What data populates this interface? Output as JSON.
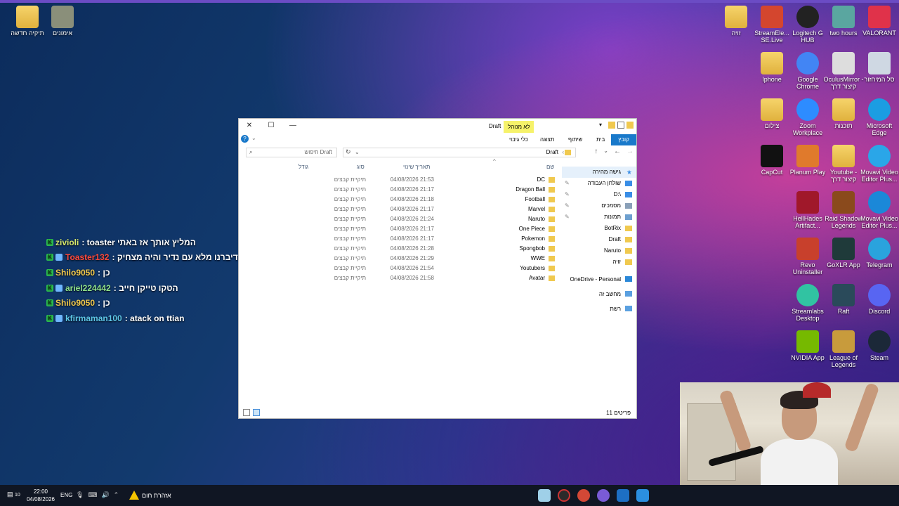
{
  "desktop": {
    "left_icons": [
      {
        "label": "תיקיה חדשה",
        "icon": "folder-icon"
      },
      {
        "label": "אימונים",
        "icon": "folder-icon"
      }
    ],
    "right_icons": [
      {
        "label": "זויה",
        "icon": "folder-icon"
      },
      {
        "label": "StreamEle... SE.Live",
        "icon": "streamelements-icon",
        "color": "#d4462e"
      },
      {
        "label": "Logitech G HUB",
        "icon": "logitech-icon",
        "color": "#222222"
      },
      {
        "label": "two hours",
        "icon": "image-icon",
        "color": "#5aa6a0"
      },
      {
        "label": "VALORANT",
        "icon": "valorant-icon",
        "color": "#e0324a"
      },
      {
        "label": "Iphone",
        "icon": "folder-icon"
      },
      {
        "label": "Google Chrome",
        "icon": "chrome-icon",
        "color": "#4285f4"
      },
      {
        "label": "OculusMirror - קיצור דרך",
        "icon": "oculus-icon",
        "color": "#dddddd"
      },
      {
        "label": "סל המיחזור",
        "icon": "recycle-bin-icon",
        "color": "#cfd8e3"
      },
      {
        "label": "צילום",
        "icon": "folder-icon"
      },
      {
        "label": "Zoom Workplace",
        "icon": "zoom-icon",
        "color": "#2d8cff"
      },
      {
        "label": "תוכנות",
        "icon": "folder-icon"
      },
      {
        "label": "Microsoft Edge",
        "icon": "edge-icon",
        "color": "#1b9de2"
      },
      {
        "label": "CapCut",
        "icon": "capcut-icon",
        "color": "#111111"
      },
      {
        "label": "Planum Play",
        "icon": "planum-icon",
        "color": "#e07a2c"
      },
      {
        "label": "Youtube - קיצור דרך",
        "icon": "folder-icon"
      },
      {
        "label": "Movavi Video Editor Plus...",
        "icon": "movavi-icon",
        "color": "#2aa6e8"
      },
      {
        "label": "HellHades Artifact...",
        "icon": "hellhades-icon",
        "color": "#a0182a"
      },
      {
        "label": "Raid Shadow Legends",
        "icon": "raid-icon",
        "color": "#8a4a1c"
      },
      {
        "label": "Movavi Video Editor Plus...",
        "icon": "movavi-icon",
        "color": "#1b88d8"
      },
      {
        "label": "Revo Uninstaller",
        "icon": "revo-icon",
        "color": "#c8402c"
      },
      {
        "label": "GoXLR App",
        "icon": "goxlr-icon",
        "color": "#1f3a3a"
      },
      {
        "label": "Telegram",
        "icon": "telegram-icon",
        "color": "#2aa3dd"
      },
      {
        "label": "Streamlabs Desktop",
        "icon": "streamlabs-icon",
        "color": "#31c3a2"
      },
      {
        "label": "Raft",
        "icon": "raft-icon",
        "color": "#2a4a5a"
      },
      {
        "label": "Discord",
        "icon": "discord-icon",
        "color": "#5865f2"
      },
      {
        "label": "NVIDIA App",
        "icon": "nvidia-icon",
        "color": "#76b900"
      },
      {
        "label": "League of Legends",
        "icon": "lol-icon",
        "color": "#c89b3c"
      },
      {
        "label": "Steam",
        "icon": "steam-icon",
        "color": "#1b2838"
      }
    ]
  },
  "chat": [
    {
      "user": "zivioli",
      "user_color": "#d7e86b",
      "msg": ": toaster המליץ אותך אז באתי"
    },
    {
      "user": "Toaster132",
      "user_color": "#ff4a3d",
      "msg": ": מחחחחח דיברנו מלא עם נדיר והיה מצחיק"
    },
    {
      "user": "Shilo9050",
      "user_color": "#f2c94c",
      "msg": ": כן"
    },
    {
      "user": "ariel224442",
      "user_color": "#8fe08a",
      "msg": ": הטקו טייקן חייב"
    },
    {
      "user": "Shilo9050",
      "user_color": "#f2c94c",
      "msg": ": כן"
    },
    {
      "user": "kfirmaman100",
      "user_color": "#5ec7e8",
      "msg": ": atack on ttian"
    }
  ],
  "explorer": {
    "title": "Draft",
    "manage_tab": "לא מנוהל",
    "ribbon": {
      "file": "קובץ",
      "home": "בית",
      "share": "שיתוף",
      "view": "תצוגה",
      "tools": "כלי גיבוי"
    },
    "search_placeholder": "חיפוש Draft",
    "address": "Draft",
    "columns": {
      "name": "שם",
      "date": "תאריך שינוי",
      "type": "סוג",
      "size": "גודל"
    },
    "files": [
      {
        "name": "DC",
        "date": "04/08/2026 21:53",
        "type": "תיקיית קבצים"
      },
      {
        "name": "Dragon Ball",
        "date": "04/08/2026 21:17",
        "type": "תיקיית קבצים"
      },
      {
        "name": "Football",
        "date": "04/08/2026 21:18",
        "type": "תיקיית קבצים"
      },
      {
        "name": "Marvel",
        "date": "04/08/2026 21:17",
        "type": "תיקיית קבצים"
      },
      {
        "name": "Naruto",
        "date": "04/08/2026 21:24",
        "type": "תיקיית קבצים"
      },
      {
        "name": "One Piece",
        "date": "04/08/2026 21:17",
        "type": "תיקיית קבצים"
      },
      {
        "name": "Pokemon",
        "date": "04/08/2026 21:17",
        "type": "תיקיית קבצים"
      },
      {
        "name": "Spongbob",
        "date": "04/08/2026 21:28",
        "type": "תיקיית קבצים"
      },
      {
        "name": "WWE",
        "date": "04/08/2026 21:29",
        "type": "תיקיית קבצים"
      },
      {
        "name": "Youtubers",
        "date": "04/08/2026 21:54",
        "type": "תיקיית קבצים"
      },
      {
        "name": "Avatar",
        "date": "04/08/2026 21:58",
        "type": "תיקיית קבצים"
      }
    ],
    "nav": [
      {
        "label": "גישה מהירה",
        "icon": "star-icon",
        "color": "#3a8ee6",
        "selected": true
      },
      {
        "label": "שולחן העבודה",
        "icon": "desktop-icon",
        "color": "#3a8ee6",
        "pinned": true
      },
      {
        "label": "D:\\",
        "icon": "download-icon",
        "color": "#3a8ee6",
        "pinned": true
      },
      {
        "label": "מסמכים",
        "icon": "document-icon",
        "color": "#8aa0b8",
        "pinned": true
      },
      {
        "label": "תמונות",
        "icon": "pictures-icon",
        "color": "#6ea0cf",
        "pinned": true
      },
      {
        "label": "BotRix",
        "icon": "folder-icon",
        "color": "#f0c94f"
      },
      {
        "label": "Draft",
        "icon": "folder-icon",
        "color": "#f0c94f"
      },
      {
        "label": "Naruto",
        "icon": "folder-icon",
        "color": "#f0c94f"
      },
      {
        "label": "זויה",
        "icon": "folder-icon",
        "color": "#f0c94f"
      },
      {
        "label": "OneDrive - Personal",
        "icon": "cloud-icon",
        "color": "#2b88d8"
      },
      {
        "label": "מחשב זה",
        "icon": "computer-icon",
        "color": "#5aa0e0"
      },
      {
        "label": "רשת",
        "icon": "network-icon",
        "color": "#5aa0e0"
      }
    ],
    "status": "11 פריטים"
  },
  "taskbar": {
    "time": "22:00",
    "date": "04/08/2026",
    "notifications": "10",
    "language": "ENG",
    "warning": "אזהרת חום"
  }
}
